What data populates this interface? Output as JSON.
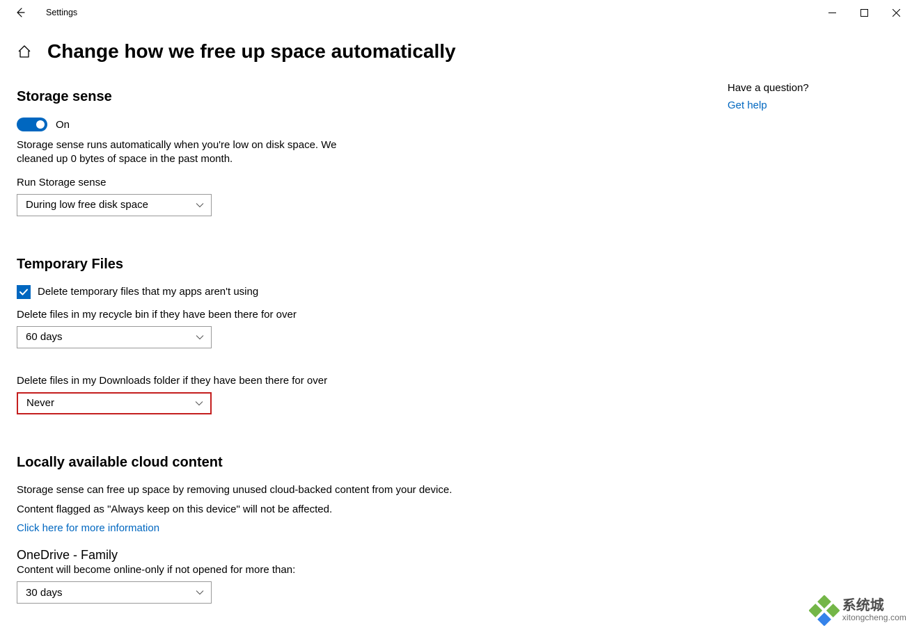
{
  "window": {
    "title": "Settings"
  },
  "page": {
    "title": "Change how we free up space automatically"
  },
  "help": {
    "question": "Have a question?",
    "link": "Get help"
  },
  "storage_sense": {
    "heading": "Storage sense",
    "toggle_label": "On",
    "description": "Storage sense runs automatically when you're low on disk space. We cleaned up 0 bytes of space in the past month.",
    "run_label": "Run Storage sense",
    "run_value": "During low free disk space"
  },
  "temporary_files": {
    "heading": "Temporary Files",
    "delete_temp_label": "Delete temporary files that my apps aren't using",
    "recycle_label": "Delete files in my recycle bin if they have been there for over",
    "recycle_value": "60 days",
    "downloads_label": "Delete files in my Downloads folder if they have been there for over",
    "downloads_value": "Never"
  },
  "cloud": {
    "heading": "Locally available cloud content",
    "desc1": "Storage sense can free up space by removing unused cloud-backed content from your device.",
    "desc2": "Content flagged as \"Always keep on this device\" will not be affected.",
    "more_info": "Click here for more information",
    "onedrive_heading": "OneDrive - Family",
    "onedrive_desc": "Content will become online-only if not opened for more than:",
    "onedrive_value": "30 days"
  },
  "watermark": {
    "cn": "系统城",
    "url": "xitongcheng.com"
  }
}
